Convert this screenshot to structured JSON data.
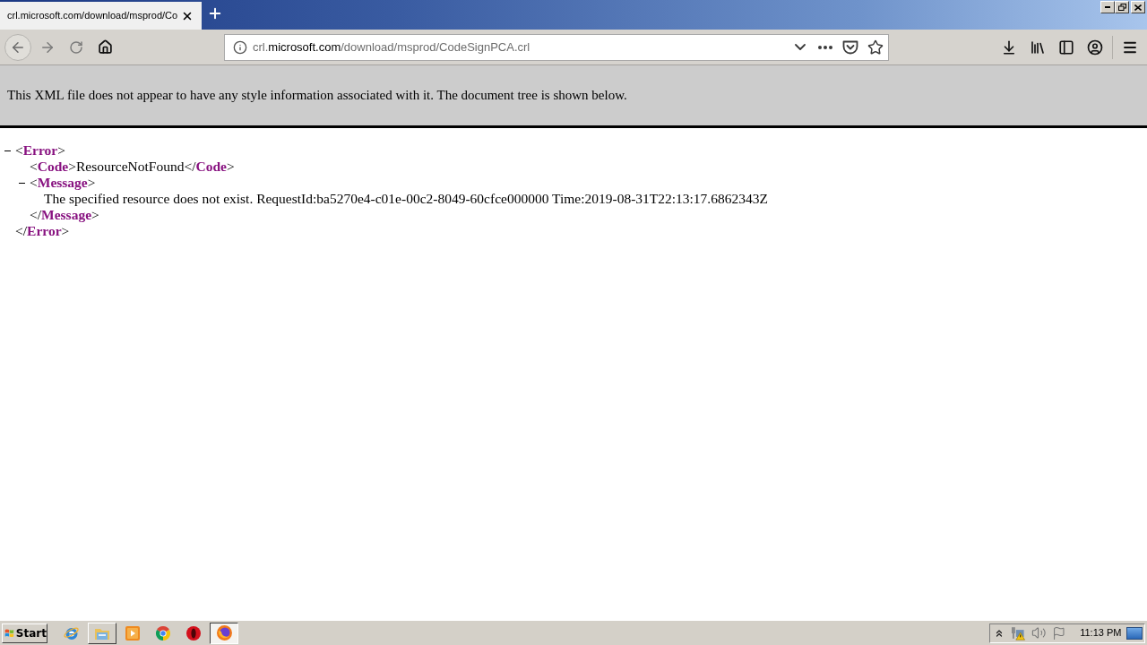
{
  "browser": {
    "tabs": [
      {
        "title": "crl.microsoft.com/download/msprod/Co",
        "selected": true
      }
    ],
    "address_bar": {
      "url_prefix": "crl.",
      "url_domain": "microsoft.com",
      "url_path": "/download/msprod/CodeSignPCA.crl"
    }
  },
  "xml_viewer": {
    "notice": "This XML file does not appear to have any style information associated with it. The document tree is shown below.",
    "tree": [
      {
        "kind": "element",
        "expanded": true,
        "open_tag": "<**Error**>",
        "close_tag": "</**Error**>",
        "children": [
          {
            "kind": "line",
            "text": "<**Code**>ResourceNotFound</**Code**>"
          },
          {
            "kind": "element",
            "expanded": true,
            "open_tag": "<**Message**>",
            "close_tag": "</**Message**>",
            "children": [
              {
                "kind": "text",
                "text": "The specified resource does not exist. RequestId:ba5270e4-c01e-00c2-8049-60cfce000000 Time:2019-08-31T22:13:17.6862343Z"
              }
            ]
          }
        ]
      }
    ]
  },
  "taskbar": {
    "start_label": "Start",
    "apps": [
      {
        "kind": "ie",
        "running": false,
        "selected": false
      },
      {
        "kind": "explorer",
        "running": true,
        "selected": false
      },
      {
        "kind": "media",
        "running": false,
        "selected": false
      },
      {
        "kind": "chrome",
        "running": false,
        "selected": false
      },
      {
        "kind": "opera",
        "running": false,
        "selected": false
      },
      {
        "kind": "firefox",
        "running": true,
        "selected": true
      }
    ],
    "clock": "11:13 PM"
  }
}
